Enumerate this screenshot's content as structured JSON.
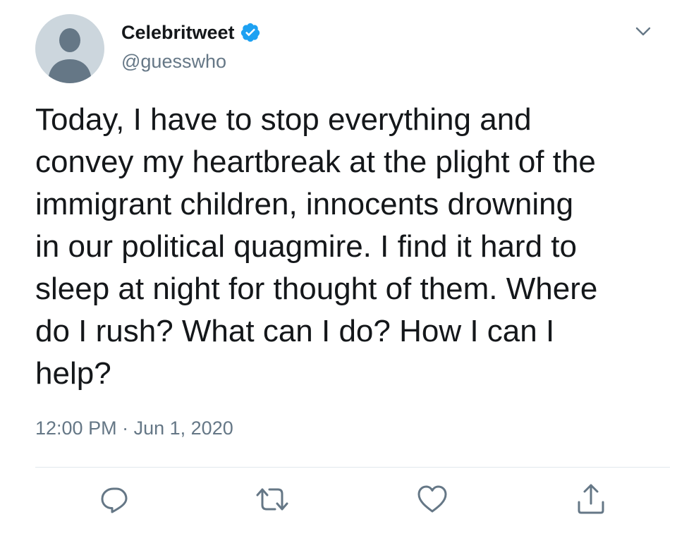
{
  "user": {
    "display_name": "Celebritweet",
    "handle": "@guesswho",
    "verified": true,
    "avatar_icon": "default-avatar-icon"
  },
  "tweet": {
    "text": "Today, I have to stop everything and\nconvey my heartbreak at the plight of the\nimmigrant children, innocents drowning\nin our political quagmire. I find it hard to\nsleep at night for thought of them. Where\ndo I rush? What can I do? How I can I\nhelp?",
    "time": "12:00 PM",
    "separator": "·",
    "date": "Jun 1, 2020"
  },
  "menu": {
    "icon": "chevron-down-icon"
  },
  "actions": [
    {
      "name": "reply",
      "icon": "reply-icon"
    },
    {
      "name": "retweet",
      "icon": "retweet-icon"
    },
    {
      "name": "like",
      "icon": "heart-icon"
    },
    {
      "name": "share",
      "icon": "share-icon"
    }
  ],
  "colors": {
    "text": "#14171a",
    "secondary": "#657786",
    "verified": "#1da1f2",
    "avatar_bg": "#ccd6dd",
    "avatar_fg": "#657786",
    "divider": "#e1e8ed"
  }
}
